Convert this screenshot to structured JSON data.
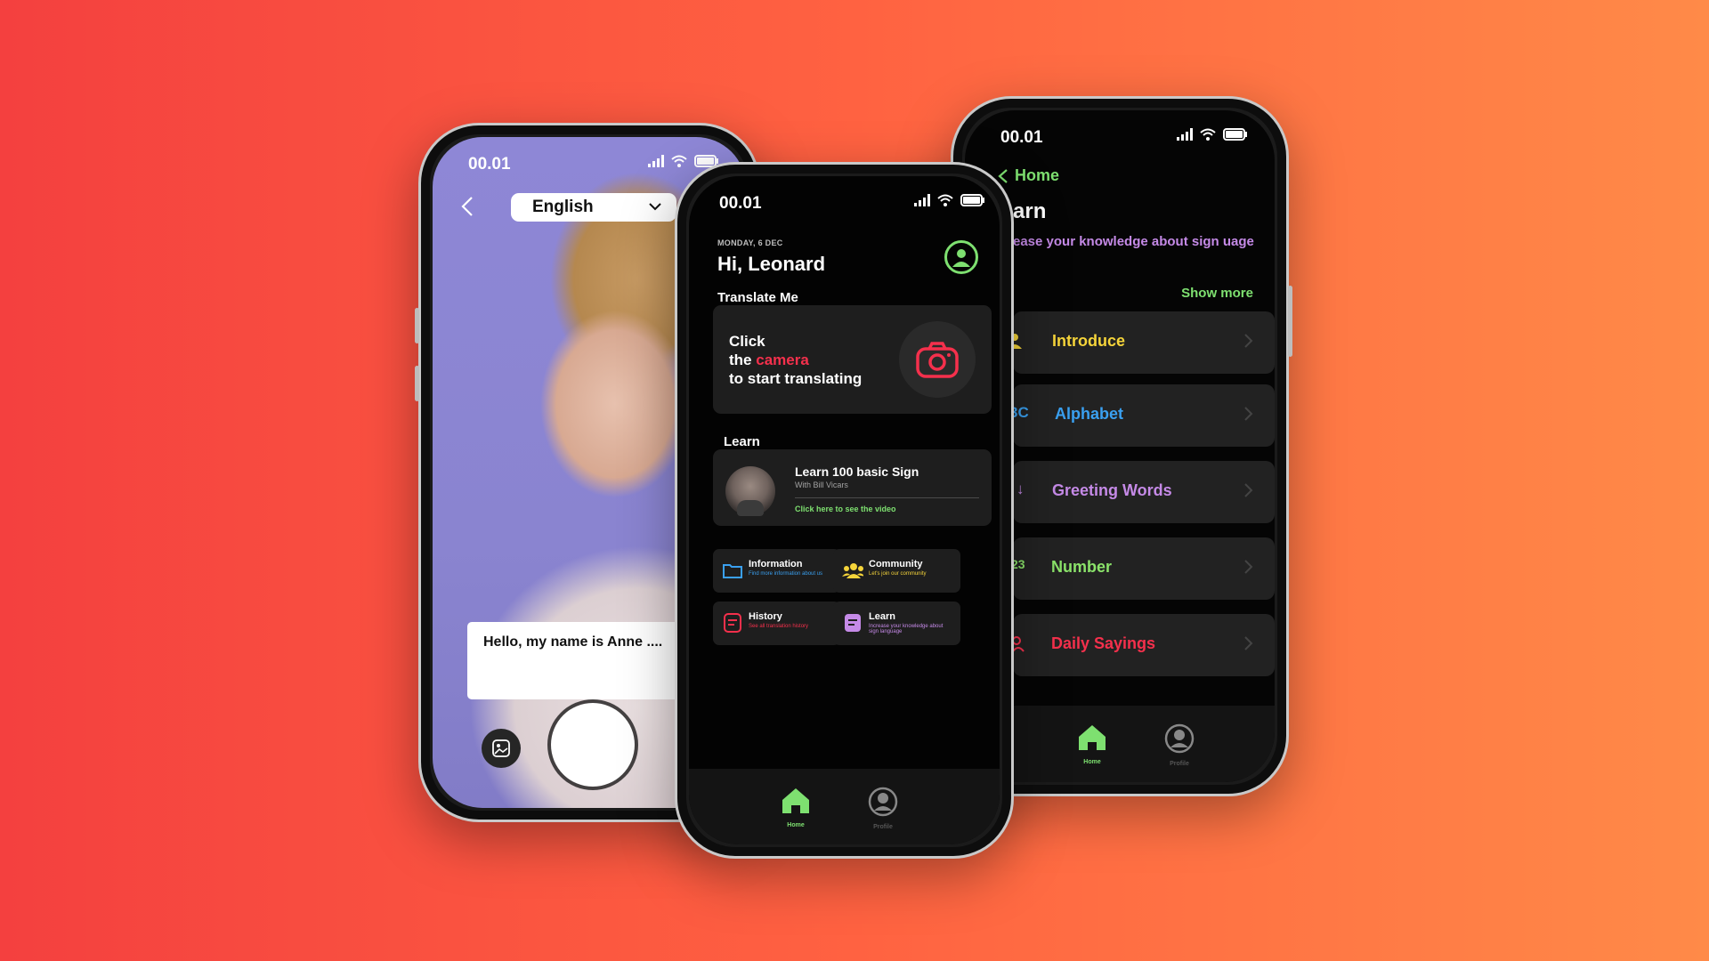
{
  "status": {
    "time": "00.01"
  },
  "camera_screen": {
    "language": "English",
    "caption": "Hello, my name is Anne ...."
  },
  "home_screen": {
    "date": "MONDAY, 6 DEC",
    "greeting": "Hi, Leonard",
    "translate_section": "Translate Me",
    "translate_line1": "Click",
    "translate_line2_pre": "the ",
    "translate_line2_word": "camera",
    "translate_line3": "to start translating",
    "learn_section": "Learn",
    "learn_card": {
      "title": "Learn 100 basic Sign",
      "subtitle": "With Bill Vicars",
      "link": "Click here to see the video"
    },
    "tiles": [
      {
        "title": "Information",
        "subtitle": "Find more information about us",
        "color": "#3aa0f0",
        "icon": "folder-icon"
      },
      {
        "title": "Community",
        "subtitle": "Let's join our community",
        "color": "#f5d43a",
        "icon": "people-icon"
      },
      {
        "title": "History",
        "subtitle": "See all translation history",
        "color": "#f5304c",
        "icon": "list-icon"
      },
      {
        "title": "Learn",
        "subtitle": "Increase your knowledge about sign language",
        "color": "#c58ae7",
        "icon": "book-icon"
      }
    ],
    "nav": {
      "home": "Home",
      "profile": "Profile"
    }
  },
  "learn_screen": {
    "back_label": "Home",
    "title": "arn",
    "subtitle": "ease your knowledge about sign uage",
    "show_more": "Show more",
    "items": [
      {
        "label": "Introduce",
        "icon_text": "",
        "color": "#f5d43a"
      },
      {
        "label": "Alphabet",
        "icon_text": "3C",
        "color": "#3aa0f0"
      },
      {
        "label": "Greeting Words",
        "icon_text": "↓",
        "color": "#c58ae7"
      },
      {
        "label": "Number",
        "icon_text": "23",
        "color": "#8be36a"
      },
      {
        "label": "Daily Sayings",
        "icon_text": "",
        "color": "#f5304c"
      }
    ],
    "nav": {
      "home": "Home",
      "profile": "Profile"
    }
  },
  "colors": {
    "accent_green": "#7ee070",
    "accent_red": "#f5304c"
  }
}
